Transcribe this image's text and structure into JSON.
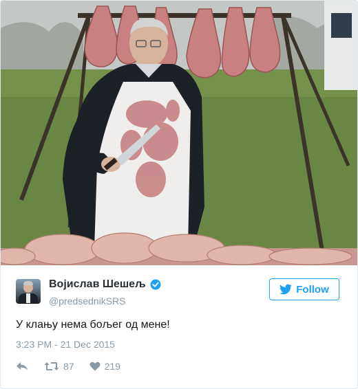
{
  "tweet": {
    "display_name": "Војислав Шешељ",
    "handle": "@predsednikSRS",
    "text": "У клању нема бољег од мене!",
    "timestamp": "3:23 PM - 21 Dec 2015",
    "retweet_count": "87",
    "like_count": "219",
    "follow_label": "Follow",
    "verified": true
  },
  "icons": {
    "twitter_bird": "twitter-bird-icon",
    "verified": "verified-badge-icon",
    "reply": "reply-icon",
    "retweet": "retweet-icon",
    "like": "heart-icon"
  },
  "colors": {
    "accent": "#1da1f2",
    "muted": "#8899a6",
    "text": "#292f33"
  }
}
